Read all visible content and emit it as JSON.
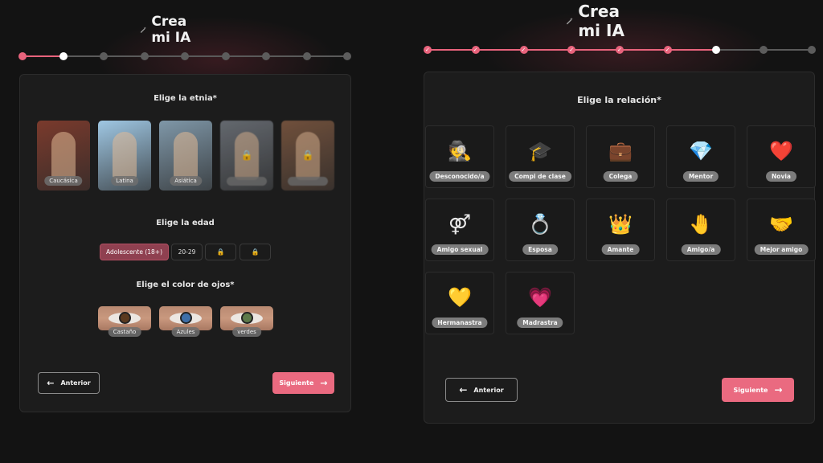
{
  "left": {
    "title": "Crea mi IA",
    "steps": {
      "total": 9,
      "completed": 1,
      "current": 2
    },
    "ethnicity": {
      "heading": "Elige la etnia*",
      "options": [
        {
          "label": "Caucásica",
          "locked": false,
          "color": "#7a3a2c"
        },
        {
          "label": "Latina",
          "locked": false,
          "color": "#9fc7e3"
        },
        {
          "label": "Asiática",
          "locked": false,
          "color": "#7f97a8"
        },
        {
          "label": "",
          "locked": true,
          "color": "#6c7178"
        },
        {
          "label": "",
          "locked": true,
          "color": "#7a5640"
        }
      ]
    },
    "age": {
      "heading": "Elige la edad",
      "options": [
        {
          "label": "Adolescente (18+)",
          "selected": true,
          "locked": false
        },
        {
          "label": "20-29",
          "selected": false,
          "locked": false
        },
        {
          "label": "",
          "selected": false,
          "locked": true
        },
        {
          "label": "",
          "selected": false,
          "locked": true
        }
      ]
    },
    "eyes": {
      "heading": "Elige el color de ojos*",
      "options": [
        {
          "label": "Castaño",
          "iris": "#5b3a1f"
        },
        {
          "label": "Azules",
          "iris": "#3e6fa8"
        },
        {
          "label": "verdes",
          "iris": "#5d7a4a"
        }
      ]
    },
    "prev_label": "Anterior",
    "next_label": "Siguiente"
  },
  "right": {
    "title": "Crea mi IA",
    "steps": {
      "total": 9,
      "completed": 6,
      "current": 7
    },
    "relation": {
      "heading": "Elige la relación*",
      "options": [
        {
          "label": "Desconocido/a",
          "emoji": "🕵"
        },
        {
          "label": "Compi de clase",
          "emoji": "🎓"
        },
        {
          "label": "Colega",
          "emoji": "💼"
        },
        {
          "label": "Mentor",
          "emoji": "💎"
        },
        {
          "label": "Novia",
          "emoji": "❤️"
        },
        {
          "label": "Amigo sexual",
          "emoji": "⚤"
        },
        {
          "label": "Esposa",
          "emoji": "💍"
        },
        {
          "label": "Amante",
          "emoji": "👑"
        },
        {
          "label": "Amigo/a",
          "emoji": "🤚"
        },
        {
          "label": "Mejor amigo",
          "emoji": "🤝"
        },
        {
          "label": "Hermanastra",
          "emoji": "💛"
        },
        {
          "label": "Madrastra",
          "emoji": "💗"
        }
      ]
    },
    "prev_label": "Anterior",
    "next_label": "Siguiente"
  },
  "colors": {
    "accent": "#e8637c",
    "selected_chip": "#8f4050",
    "card_bg": "#1c1c1c",
    "page_bg": "#131313"
  },
  "icons": {
    "title": "magic-wand-icon",
    "prev": "arrow-left-icon",
    "next": "arrow-right-icon",
    "lock": "lock-icon"
  }
}
